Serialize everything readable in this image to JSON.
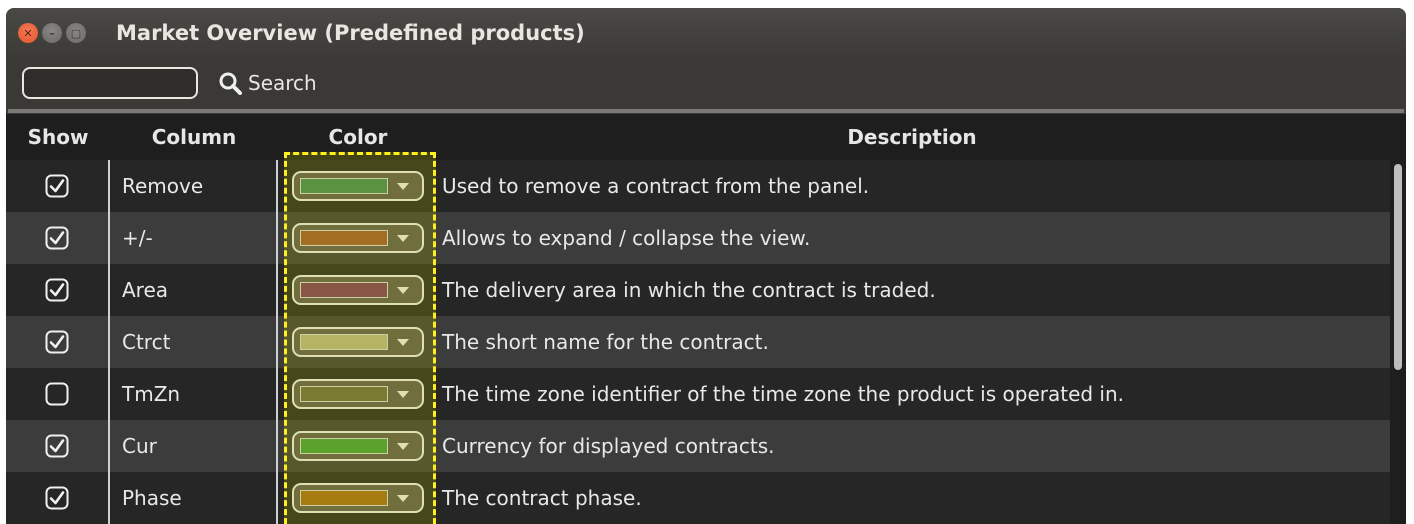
{
  "window": {
    "title": "Market Overview (Predefined products)"
  },
  "search": {
    "value": "",
    "label": "Search"
  },
  "table": {
    "headers": {
      "show": "Show",
      "column": "Column",
      "color": "Color",
      "description": "Description"
    },
    "rows": [
      {
        "show": true,
        "column": "Remove",
        "color": "#3f8a58",
        "description": "Used to remove a contract from the panel."
      },
      {
        "show": true,
        "column": "+/-",
        "color": "#a0582f",
        "description": "Allows to expand / collapse the view."
      },
      {
        "show": true,
        "column": "Area",
        "color": "#7e3a5c",
        "description": "The delivery area in which the contract is traded."
      },
      {
        "show": true,
        "column": "Ctrct",
        "color": "#b8b787",
        "description": "The short name for the contract."
      },
      {
        "show": false,
        "column": "TmZn",
        "color": "#6b6a45",
        "description": "The time zone identifier of the time zone the product is operated in."
      },
      {
        "show": true,
        "column": "Cur",
        "color": "#3f9f3a",
        "description": "Currency for displayed contracts."
      },
      {
        "show": true,
        "column": "Phase",
        "color": "#a46b14",
        "description": "The contract phase."
      }
    ]
  },
  "icons": {
    "close": "close-icon",
    "minimize": "minimize-icon",
    "maximize": "maximize-icon",
    "search": "search-icon",
    "checkbox": "checkbox-icon",
    "dropdown": "chevron-down-icon"
  },
  "colors": {
    "highlight": "#ffef1c",
    "background": "#3a3936"
  }
}
